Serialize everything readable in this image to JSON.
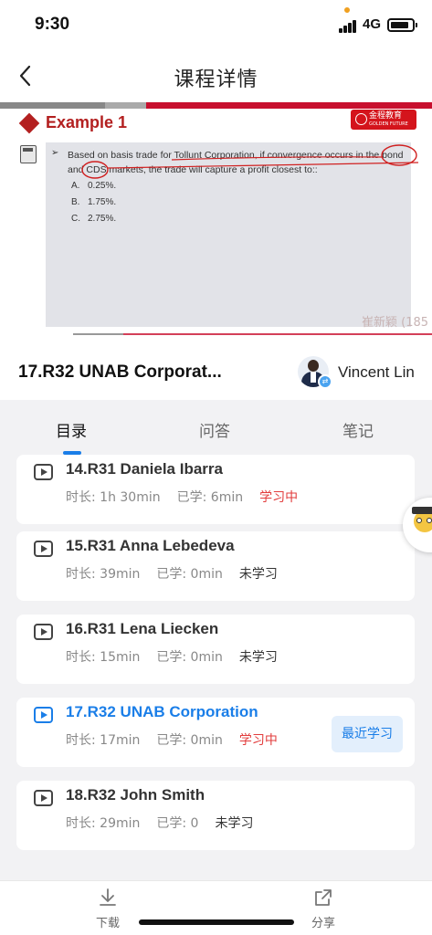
{
  "status_bar": {
    "time": "9:30",
    "network": "4G",
    "battery_level": 0.85
  },
  "nav": {
    "title": "课程详情"
  },
  "video": {
    "example_title": "Example 1",
    "brand_logo_text": "金程教育",
    "brand_logo_sub": "GOLDEN FUTURE",
    "question_text": "Based on basis trade for Tollunt Corporation, if convergence occurs in the bond and CDS markets, the trade will capture a profit closest to::",
    "options": [
      {
        "letter": "A.",
        "text": "0.25%."
      },
      {
        "letter": "B.",
        "text": "1.75%."
      },
      {
        "letter": "C.",
        "text": "2.75%."
      }
    ],
    "watermark": "崔新颖 (185"
  },
  "course": {
    "title": "17.R32 UNAB Corporat...",
    "teacher_name": "Vincent Lin"
  },
  "tabs": [
    {
      "label": "目录",
      "active": true
    },
    {
      "label": "问答",
      "active": false
    },
    {
      "label": "笔记",
      "active": false
    }
  ],
  "lessons": [
    {
      "title": "14.R31 Daniela Ibarra",
      "duration": "时长: 1h 30min",
      "learned": "已学: 6min",
      "status": "学习中",
      "status_type": "learning",
      "current": false
    },
    {
      "title": "15.R31 Anna Lebedeva",
      "duration": "时长: 39min",
      "learned": "已学: 0min",
      "status": "未学习",
      "status_type": "unlearned",
      "current": false
    },
    {
      "title": "16.R31 Lena Liecken",
      "duration": "时长: 15min",
      "learned": "已学: 0min",
      "status": "未学习",
      "status_type": "unlearned",
      "current": false
    },
    {
      "title": "17.R32 UNAB Corporation",
      "duration": "时长: 17min",
      "learned": "已学: 0min",
      "status": "学习中",
      "status_type": "learning",
      "current": true,
      "badge": "最近学习"
    },
    {
      "title": "18.R32 John Smith",
      "duration": "时长: 29min",
      "learned": "已学: 0",
      "status": "未学习",
      "status_type": "unlearned",
      "current": false
    }
  ],
  "bottom_bar": {
    "download_label": "下载",
    "share_label": "分享"
  },
  "colors": {
    "accent": "#1a7ee8",
    "learning": "#e23c3c",
    "brand_red": "#c8102e"
  }
}
